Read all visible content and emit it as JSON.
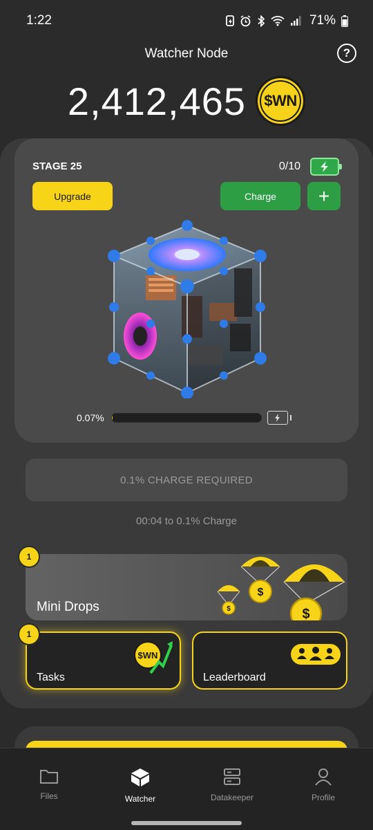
{
  "status_bar": {
    "time": "1:22",
    "battery_percent": "71%",
    "icons": [
      "notification-icon",
      "alarm-icon",
      "bluetooth-icon",
      "wifi-icon",
      "signal-icon",
      "battery-icon"
    ]
  },
  "header": {
    "title": "Watcher Node",
    "help_icon": "help-icon"
  },
  "balance": {
    "value": "2,412,465",
    "coin_label": "$WN"
  },
  "node": {
    "stage_label": "STAGE 25",
    "charges": "0/10",
    "upgrade_label": "Upgrade",
    "charge_label": "Charge",
    "plus_label": "+",
    "progress_text": "0.07%",
    "progress_fraction": 0.0007
  },
  "charge_required": {
    "label": "0.1% CHARGE REQUIRED",
    "timer": "00:04 to 0.1% Charge"
  },
  "mini_drops": {
    "label": "Mini Drops",
    "badge": "1"
  },
  "tasks": {
    "label": "Tasks",
    "badge": "1",
    "coin_label": "$WN"
  },
  "leaderboard": {
    "label": "Leaderboard"
  },
  "bottom_nav": {
    "items": [
      {
        "label": "Files",
        "icon": "folder-icon"
      },
      {
        "label": "Watcher",
        "icon": "cube-icon"
      },
      {
        "label": "Datakeeper",
        "icon": "server-icon"
      },
      {
        "label": "Profile",
        "icon": "person-icon"
      }
    ],
    "active": "Watcher"
  },
  "colors": {
    "background": "#2b2b2b",
    "panel": "#3a3a3a",
    "card": "#4a4a4a",
    "accent_yellow": "#f7d417",
    "accent_green": "#2e9e44"
  }
}
